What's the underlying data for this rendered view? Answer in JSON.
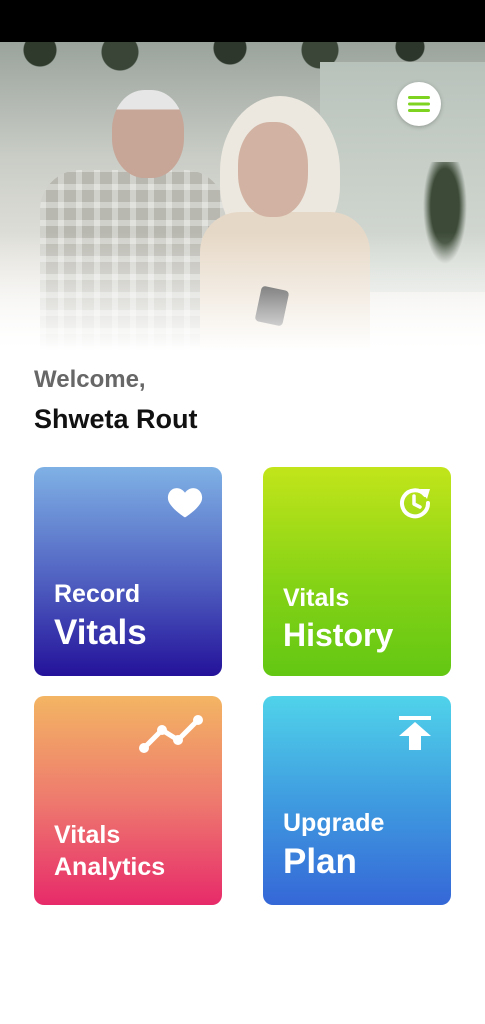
{
  "menu": {
    "icon": "hamburger-menu-icon"
  },
  "greeting": {
    "welcome": "Welcome,",
    "name": "Shweta Rout"
  },
  "tiles": {
    "record": {
      "line1": "Record",
      "line2": "Vitals",
      "icon": "heart-icon"
    },
    "history": {
      "line1": "Vitals",
      "line2": "History",
      "icon": "history-clock-icon"
    },
    "analytics": {
      "line1": "Vitals",
      "line2": "Analytics",
      "icon": "trend-line-icon"
    },
    "upgrade": {
      "line1": "Upgrade",
      "line2": "Plan",
      "icon": "upload-arrow-icon"
    }
  },
  "colors": {
    "accent_green": "#7ed321",
    "record": [
      "#7fb1e5",
      "#24129a"
    ],
    "history": [
      "#c2e51a",
      "#63c713"
    ],
    "analytics": [
      "#f3b563",
      "#e72a6a"
    ],
    "upgrade": [
      "#50d3ea",
      "#3567d7"
    ]
  }
}
